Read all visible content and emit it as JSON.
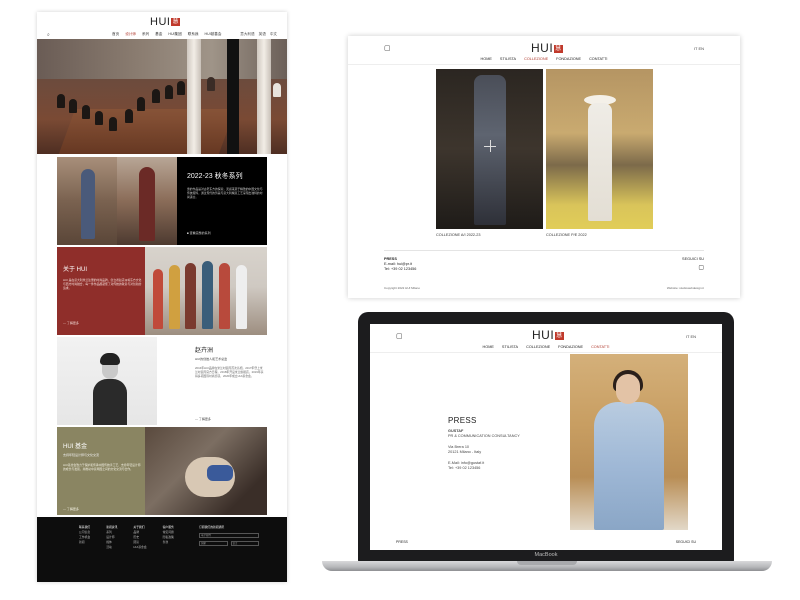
{
  "brand": {
    "logo_text": "HUI",
    "logo_seal": "慧"
  },
  "mobile_page": {
    "search_icon": "search-icon",
    "nav": [
      "首页",
      "设计师",
      "系列",
      "基金",
      "HUI集团",
      "联系我",
      "HUI慈善会"
    ],
    "active_nav_index": 1,
    "lang": [
      "意大利语",
      "英语",
      "中文"
    ],
    "collection": {
      "title": "2022-23 秋冬系列",
      "body": "惠的作品是对古老东方的探索，灵感来源于精致的中国文化与传统服饰，通过现代的剪裁与意大利精湛工艺呈现出独特的时尚语言。",
      "more": "查看完整的系列"
    },
    "about": {
      "title": "关于 HUI",
      "body": "HUI 是在意大利米兰注册的时尚品牌，创立者赵卉洲将东方文化与西方时尚融合，每一件作品都凝聚了对传统的敬意与对创新的追求。",
      "more": "了解更多"
    },
    "designer": {
      "title": "赵卉洲",
      "subtitle": "HUI的创始人和艺术总监",
      "body": "2016年HUI品牌在米兰时装周首次亮相，2017年登上米兰时装周官方日程，2018年开设米兰旗舰店，2019年获得多项国际时尚奖项，2020年成立HUI基金会。",
      "more": "了解更多"
    },
    "foundation": {
      "title": "HUI 基金",
      "subtitle": "支持年轻设计师与文化交流",
      "body": "HUI基金会致力于保护和传承中国传统手工艺，支持年轻设计师的成长与发展，并推动中意两国之间的文化交流与合作。",
      "more": "了解更多"
    },
    "footer": {
      "columns": [
        {
          "heading": "联系我们",
          "items": [
            "公司信息",
            "工作机会",
            "新闻"
          ]
        },
        {
          "heading": "新闻资讯",
          "items": [
            "系列",
            "设计师",
            "媒体",
            "活动"
          ]
        },
        {
          "heading": "关于我们",
          "items": [
            "品牌",
            "历史",
            "团队",
            "HUI基金会"
          ]
        },
        {
          "heading": "客户服务",
          "items": [
            "常见问题",
            "隐私政策",
            "条款"
          ]
        }
      ],
      "newsletter_heading": "订阅我们的新闻通讯",
      "email_placeholder": "电子邮件",
      "select_a": "国家",
      "select_b": "语言"
    }
  },
  "desktop_page": {
    "nav": [
      "HOME",
      "STILISTA",
      "COLLEZIONE",
      "FONDAZIONE",
      "CONTATTI"
    ],
    "active_nav_index": 2,
    "lang": "IT  EN",
    "cards": [
      {
        "caption": "COLLEZIONE A/I 2022-23"
      },
      {
        "caption": "COLLEZIONE P/E 2022"
      }
    ],
    "press_heading": "PRESS",
    "press_lines": [
      "E-mail: hui@pr.it",
      "Tel: +39 02 123456"
    ],
    "follow": "SEGUICI SU",
    "copyright": "Copyright 2022 HUI Milano",
    "design_credit": "Website: studiowebdesign.it"
  },
  "laptop_page": {
    "nav": [
      "HOME",
      "STILISTA",
      "COLLEZIONE",
      "FONDAZIONE",
      "CONTATTI"
    ],
    "active_nav_index": 4,
    "lang": "IT  EN",
    "press_heading": "PRESS",
    "agency_name": "GUSTAF",
    "agency_desc": "PR & COMMUNICATION CONSULTANCY",
    "address_1": "Via Brera 10",
    "address_2": "20121 Milano - Italy",
    "email": "E-Mail: info@gustaf.it",
    "tel": "Tel: +39 02 123456",
    "footer_left": "PRESS",
    "footer_right": "SEGUICI SU",
    "device_label": "MacBook"
  }
}
